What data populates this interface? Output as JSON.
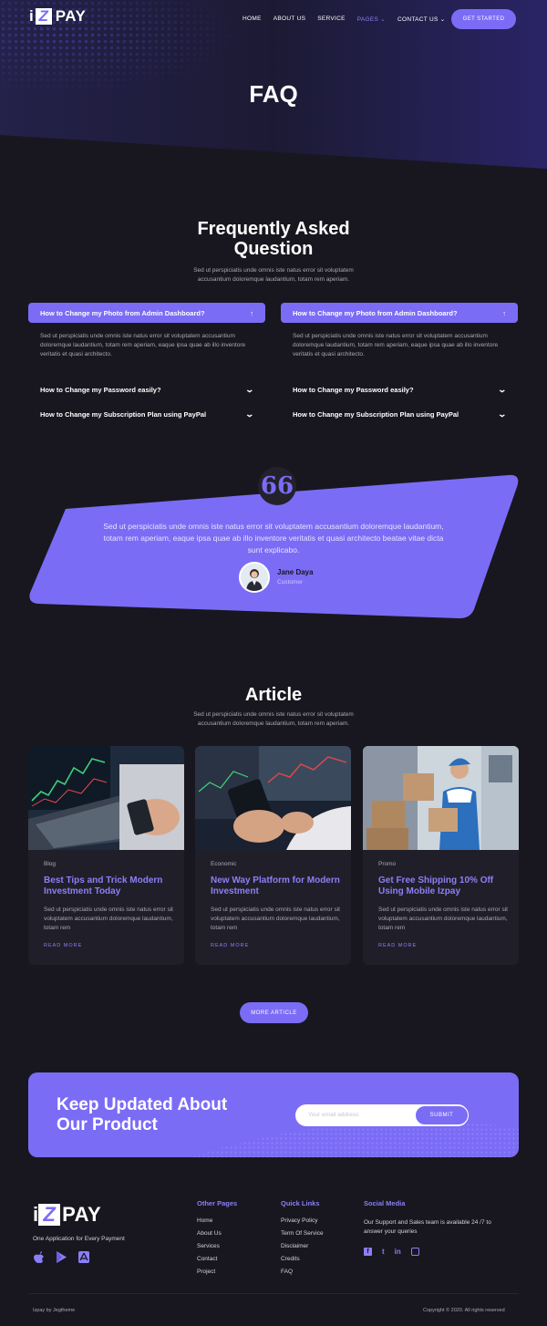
{
  "brand": {
    "logo_letter": "Z",
    "logo_prefix": "i",
    "logo_name": "PAY"
  },
  "nav": {
    "items": [
      {
        "label": "HOME"
      },
      {
        "label": "ABOUT US"
      },
      {
        "label": "SERVICE"
      },
      {
        "label": "PAGES",
        "active": true,
        "has_dropdown": true
      },
      {
        "label": "CONTACT US",
        "has_dropdown": true
      }
    ],
    "cta": "GET STARTED"
  },
  "hero": {
    "title": "FAQ"
  },
  "faq": {
    "title_line1": "Frequently Asked",
    "title_line2": "Question",
    "subtitle_line1": "Sed ut perspiciatis unde omnis iste natus error sit voluptatem",
    "subtitle_line2": "accusantium doloremque laudantium, totam rem aperiam.",
    "columns": [
      {
        "open_question": "How to Change my Photo from Admin Dashboard?",
        "answer": "Sed ut perspiciatis unde omnis iste natus error sit voluptatem accusantium doloremque laudantium, totam rem aperiam, eaque ipsa quae ab illo inventore veritatis et quasi architecto.",
        "questions": [
          "How to Change my Password easily?",
          "How to Change my Subscription Plan using PayPal"
        ]
      },
      {
        "open_question": "How to Change my Photo from Admin Dashboard?",
        "answer": "Sed ut perspiciatis unde omnis iste natus error sit voluptatem accusantium doloremque laudantium, totam rem aperiam, eaque ipsa quae ab illo inventore veritatis et quasi architecto.",
        "questions": [
          "How to Change my Password easily?",
          "How to Change my Subscription Plan using PayPal"
        ]
      }
    ]
  },
  "testimonial": {
    "quote_mark": "66",
    "text": "Sed ut perspiciatis unde omnis iste natus error sit voluptatem accusantium doloremque laudantium, totam rem aperiam, eaque ipsa quae ab illo inventore veritatis et quasi architecto beatae vitae dicta sunt explicabo.",
    "name": "Jane Daya",
    "role": "Customer"
  },
  "articles": {
    "title": "Article",
    "subtitle_line1": "Sed ut perspiciatis unde omnis iste natus error sit voluptatem",
    "subtitle_line2": "accusantium doloremque laudantium, totam rem aperiam.",
    "cards": [
      {
        "category": "Blog",
        "title": "Best Tips and Trick Modern Investment Today",
        "text": "Sed ut perspiciatis unde omnis iste natus error sit voluptatem accusantium doloremque laudantium, totam rem",
        "more": "READ MORE"
      },
      {
        "category": "Economic",
        "title": "New Way Platform for Modern Investment",
        "text": "Sed ut perspiciatis unde omnis iste natus error sit voluptatem accusantium doloremque laudantium, totam rem",
        "more": "READ MORE"
      },
      {
        "category": "Promo",
        "title": "Get Free Shipping 10% Off Using Mobile Izpay",
        "text": "Sed ut perspiciatis unde omnis iste natus error sit voluptatem accusantium doloremque laudantium, totam rem",
        "more": "READ MORE"
      }
    ],
    "more_button": "MORE ARTICLE"
  },
  "newsletter": {
    "title_line1": "Keep Updated About",
    "title_line2": "Our Product",
    "placeholder": "Your email address",
    "submit": "SUBMIT"
  },
  "footer": {
    "tagline": "One Application for Every Payment",
    "app_icons": [
      "apple-icon",
      "play-store-icon",
      "app-store-icon"
    ],
    "other_pages": {
      "title": "Other Pages",
      "links": [
        "Home",
        "About Us",
        "Services",
        "Contact",
        "Project"
      ]
    },
    "quick_links": {
      "title": "Quick Links",
      "links": [
        "Privacy Policy",
        "Term Of Service",
        "Disclaimer",
        "Credits",
        "FAQ"
      ]
    },
    "social": {
      "title": "Social Media",
      "desc": "Our Support and Sales team is available 24 /7 to answer your queries",
      "icons": [
        "f",
        "t",
        "in",
        "ig"
      ]
    },
    "copy_left": "Izpay by Jegtheme",
    "copy_right": "Copyright © 2020. All rights reserved"
  },
  "colors": {
    "accent": "#7b6cf6",
    "background": "#18171f",
    "card": "#201f29"
  }
}
